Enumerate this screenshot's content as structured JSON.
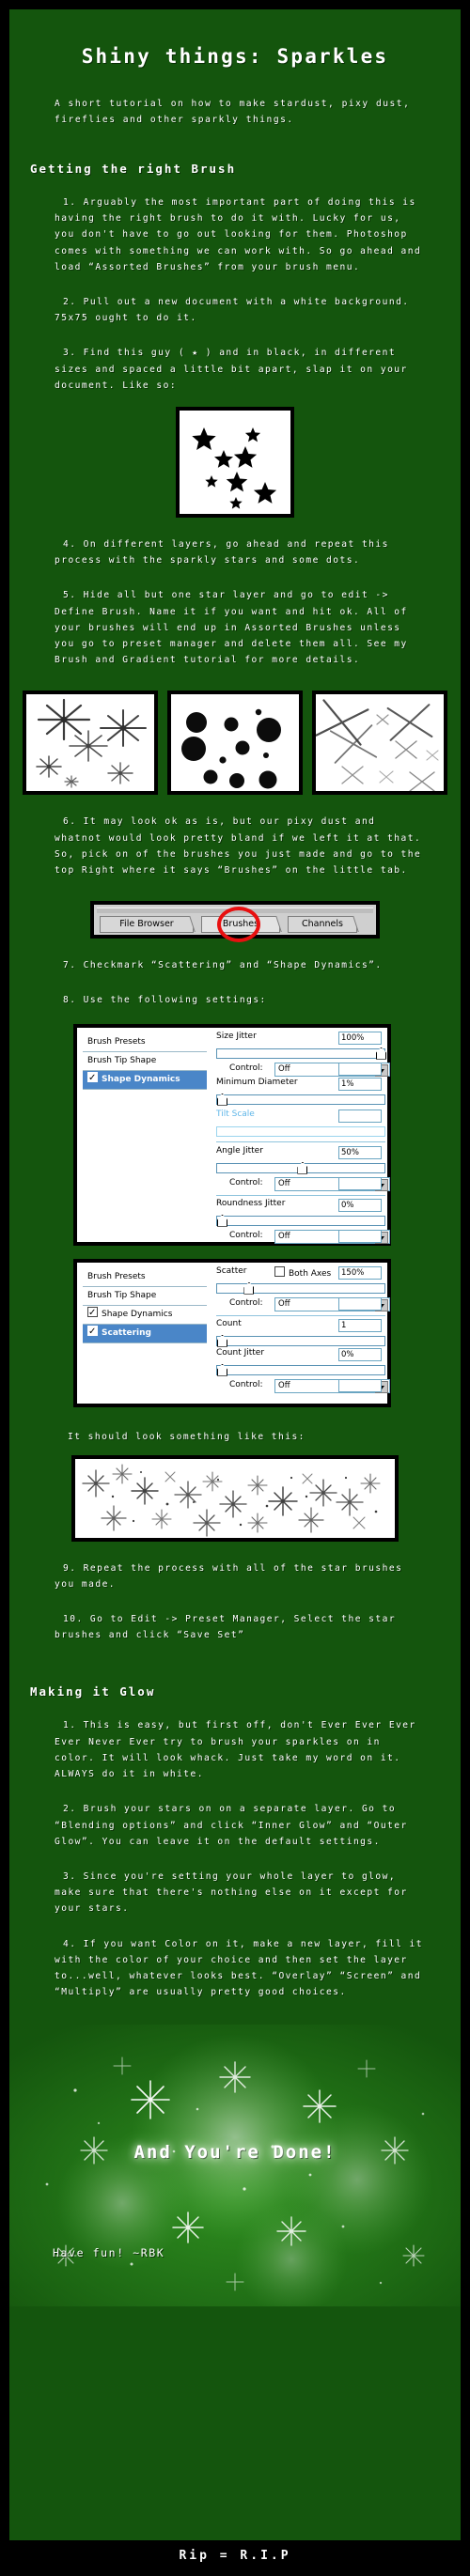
{
  "document": {
    "title": "Shiny things: Sparkles",
    "subtitle": "A short tutorial on how to make stardust, pixy dust, fireflies and other sparkly things.",
    "footer": "Rip = R.I.P"
  },
  "sections": [
    {
      "heading": "Getting the right Brush",
      "steps": [
        "1. Arguably the most important part of doing this is having the right brush to do it with. Lucky for us, you don't have to go out looking for them. Photoshop comes with something we can work with. So go ahead and load “Assorted Brushes” from your brush menu.",
        "2. Pull out a new document with a white background. 75x75 ought to do it.",
        "3. Find this guy ( ★ ) and in black, in different sizes and spaced a little bit apart, slap it on your document. Like so:",
        "4. On different layers, go ahead and repeat this process with the sparkly stars and some dots.",
        "5. Hide all but one star layer and go to edit -> Define Brush. Name it if you want and hit ok. All of your brushes will end up in Assorted Brushes unless you go to preset manager and delete them all. See my Brush and Gradient tutorial for more details.",
        "6. It may look ok as is, but our pixy dust and whatnot would look pretty bland if we left it at that. So, pick on of the brushes you just made and go to the top Right where it says “Brushes” on the little tab.",
        "7. Checkmark “Scattering” and “Shape Dynamics”.",
        "8. Use the following settings:",
        "9. Repeat the process with all of the star brushes you made.",
        "10. Go to Edit -> Preset Manager, Select the star brushes and click “Save Set”"
      ]
    },
    {
      "heading": "Making it Glow",
      "steps": [
        "1. This is easy, but first off, don't Ever Ever Ever Ever Never Ever try to brush your sparkles on in color. It will look whack. Just take my word on it. ALWAYS do it in white.",
        "2. Brush your stars on on a separate layer. Go to “Blending options” and click “Inner Glow” and “Outer Glow”. You can leave it on the default settings.",
        "3. Since you're setting your whole layer to glow, make sure that there's nothing else on it except for your stars.",
        "4. If you want Color on it, make a new layer, fill it with the color of your choice and then set the layer to...well, whatever looks best. “Overlay” “Screen” and “Multiply” are usually pretty good choices."
      ]
    }
  ],
  "captions": {
    "result_preview": "It should look something like this:"
  },
  "tab_strip": {
    "tabs": [
      {
        "label": "File Browser",
        "highlighted": false
      },
      {
        "label": "Brushes",
        "highlighted": true
      },
      {
        "label": "Channels",
        "highlighted": false
      }
    ],
    "highlight_color": "#e81010"
  },
  "brush_panels": [
    {
      "name": "shape-dynamics-panel",
      "list": [
        {
          "label": "Brush Presets",
          "checkbox": null,
          "selected": false
        },
        {
          "label": "Brush Tip Shape",
          "checkbox": null,
          "selected": false
        },
        {
          "label": "Shape Dynamics",
          "checkbox": true,
          "selected": true
        }
      ],
      "controls": [
        {
          "label": "Size Jitter",
          "value": "100%",
          "slider_pct": 100
        },
        {
          "label": "Control:",
          "value": "Off",
          "type": "dropdown"
        },
        {
          "label": "Minimum Diameter",
          "value": "1%",
          "slider_pct": 1
        },
        {
          "label": "Tilt Scale",
          "value": "",
          "disabled": true
        },
        {
          "label": "Angle Jitter",
          "value": "50%",
          "slider_pct": 50
        },
        {
          "label": "Control:",
          "value": "Off",
          "type": "dropdown"
        },
        {
          "label": "Roundness Jitter",
          "value": "0%",
          "slider_pct": 0
        },
        {
          "label": "Control:",
          "value": "Off",
          "type": "dropdown"
        }
      ]
    },
    {
      "name": "scattering-panel",
      "list": [
        {
          "label": "Brush Presets",
          "checkbox": null,
          "selected": false
        },
        {
          "label": "Brush Tip Shape",
          "checkbox": null,
          "selected": false
        },
        {
          "label": "Shape Dynamics",
          "checkbox": true,
          "selected": false
        },
        {
          "label": "Scattering",
          "checkbox": true,
          "selected": true
        }
      ],
      "controls": [
        {
          "label": "Scatter",
          "value": "150%",
          "slider_pct": 16,
          "extra_label": "Both Axes",
          "extra_checked": false
        },
        {
          "label": "Control:",
          "value": "Off",
          "type": "dropdown"
        },
        {
          "label": "Count",
          "value": "1",
          "slider_pct": 0
        },
        {
          "label": "Count Jitter",
          "value": "0%",
          "slider_pct": 0
        },
        {
          "label": "Control:",
          "value": "Off",
          "type": "dropdown"
        }
      ]
    }
  ],
  "glow_banner": {
    "done_text": "And You're Done!",
    "signature": "Have fun! ~RBK"
  },
  "colors": {
    "background": "#000000",
    "panel_green": "#14550d",
    "text": "#ffffff",
    "accent_red": "#e81010",
    "ps_select_blue": "#4a86c8"
  }
}
